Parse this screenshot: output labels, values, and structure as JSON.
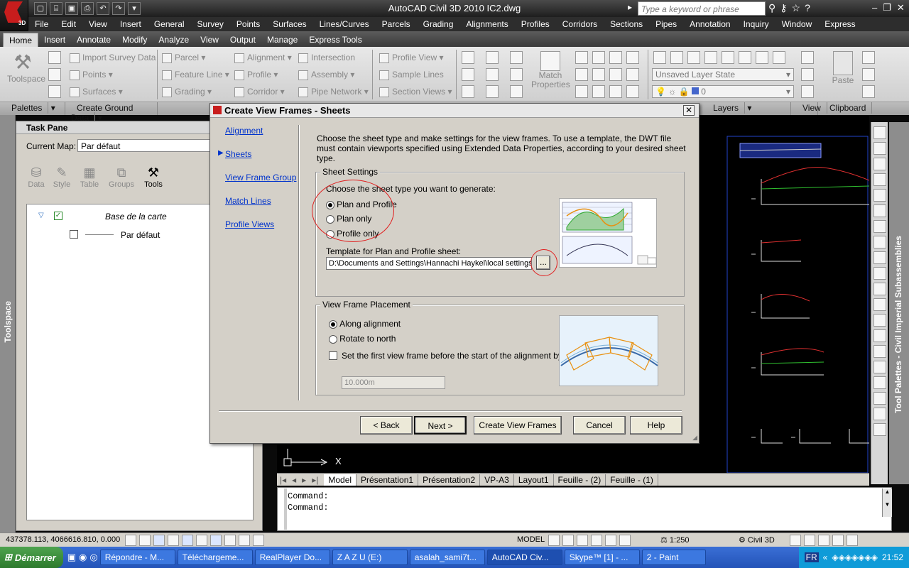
{
  "window": {
    "title": "AutoCAD Civil 3D 2010    IC2.dwg",
    "logo_text": "3D",
    "search_placeholder": "Type a keyword or phrase"
  },
  "menu": [
    "File",
    "Edit",
    "View",
    "Insert",
    "General",
    "Survey",
    "Points",
    "Surfaces",
    "Lines/Curves",
    "Parcels",
    "Grading",
    "Alignments",
    "Profiles",
    "Corridors",
    "Sections",
    "Pipes",
    "Annotation",
    "Inquiry",
    "Window",
    "Express"
  ],
  "ribbon_tabs": [
    "Home",
    "Insert",
    "Annotate",
    "Modify",
    "Analyze",
    "View",
    "Output",
    "Manage",
    "Express Tools"
  ],
  "ribbon": {
    "toolspace": "Toolspace",
    "import_survey": "Import Survey Data",
    "points": "Points",
    "surfaces": "Surfaces",
    "parcel": "Parcel",
    "feature_line": "Feature Line",
    "grading": "Grading",
    "alignment": "Alignment",
    "profile": "Profile",
    "corridor": "Corridor",
    "intersection": "Intersection",
    "assembly": "Assembly",
    "pipe_network": "Pipe Network",
    "profile_view": "Profile View",
    "sample_lines": "Sample Lines",
    "section_views": "Section Views",
    "match_properties": "Match Properties",
    "layer_state": "Unsaved Layer State",
    "layer_current": "0",
    "paste": "Paste"
  },
  "panels": [
    "Palettes",
    "Create Ground Data",
    "Layers",
    "View",
    "Clipboard"
  ],
  "taskpane": {
    "title": "Task Pane",
    "current_map_label": "Current Map:",
    "current_map_value": "Par défaut",
    "tools": [
      "Data",
      "Style",
      "Table",
      "Groups",
      "Tools"
    ],
    "tree_root": "Base de la carte",
    "tree_child": "Par défaut"
  },
  "side_labels": {
    "left": "Toolspace",
    "right": "Tool Palettes - Civil Imperial Subassemblies"
  },
  "model_tabs": [
    "Model",
    "Présentation1",
    "Présentation2",
    "VP-A3",
    "Layout1",
    "Feuille - (2)",
    "Feuille - (1)"
  ],
  "command_lines": [
    "Command:",
    "Command:"
  ],
  "status": {
    "coords": "437378.113, 4066616.810, 0.000",
    "model": "MODEL",
    "scale": "1:250",
    "workspace": "Civil 3D"
  },
  "axis_label": "X",
  "dialog": {
    "title": "Create View Frames - Sheets",
    "nav": [
      "Alignment",
      "Sheets",
      "View Frame Group",
      "Match Lines",
      "Profile Views"
    ],
    "active_nav": "Sheets",
    "intro": "Choose the sheet type and make settings for the view frames. To use a template, the DWT file must contain viewports specified using Extended Data Properties, according to your desired sheet type.",
    "sheet_settings_label": "Sheet Settings",
    "sheet_type_prompt": "Choose the sheet type you want to generate:",
    "sheet_types": [
      "Plan and Profile",
      "Plan only",
      "Profile only"
    ],
    "selected_sheet_type": "Plan and Profile",
    "template_label": "Template for Plan and Profile sheet:",
    "template_value": "D:\\Documents and Settings\\Hannachi Haykel\\local settings",
    "browse_label": "...",
    "placement_label": "View Frame Placement",
    "placement_options": [
      "Along alignment",
      "Rotate to north"
    ],
    "selected_placement": "Along alignment",
    "first_frame_label": "Set the first view frame before the start of the alignment by:",
    "first_frame_value": "10.000m",
    "buttons": {
      "back": "< Back",
      "next": "Next >",
      "create": "Create View Frames",
      "cancel": "Cancel",
      "help": "Help"
    }
  },
  "taskbar": {
    "start": "Démarrer",
    "tasks": [
      "Répondre - M...",
      "Télécharg​eme...",
      "RealPlayer Do...",
      "Z A Z U (E:)",
      "asalah_sami7t...",
      "AutoCAD Civ...",
      "Skype™ [1] - ...",
      "2 - Paint"
    ],
    "active_task": "AutoCAD Civ...",
    "lang": "FR",
    "clock": "21:52"
  },
  "colors": {
    "accent": "#0033cc",
    "highlight_circle": "#e02020",
    "taskbar": "#2353b8"
  }
}
